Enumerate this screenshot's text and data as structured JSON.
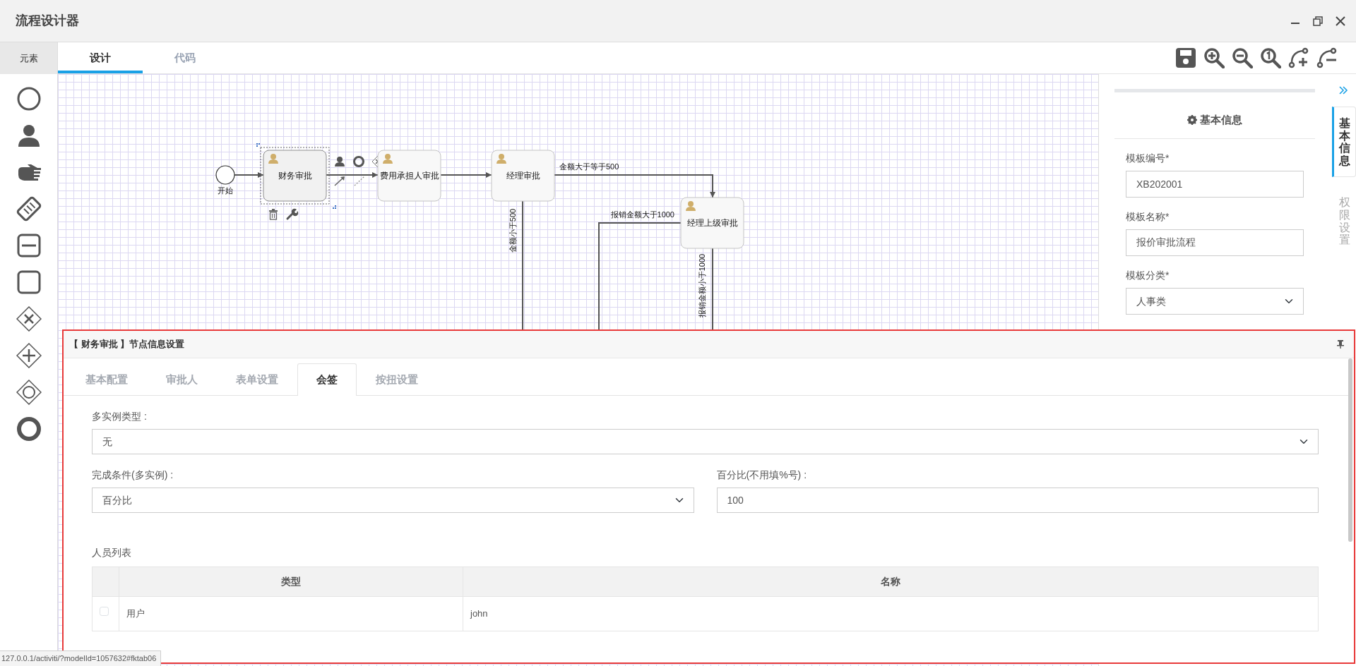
{
  "window": {
    "title": "流程设计器"
  },
  "sidebar": {
    "header": "元素"
  },
  "tabs": [
    {
      "label": "设计",
      "selected": true
    },
    {
      "label": "代码",
      "selected": false
    }
  ],
  "diagram": {
    "nodes": [
      {
        "kind": "start",
        "label": "开始",
        "selected": false
      },
      {
        "kind": "task",
        "label": "财务审批",
        "selected": true
      },
      {
        "kind": "task",
        "label": "费用承担人审批",
        "selected": false
      },
      {
        "kind": "task",
        "label": "经理审批",
        "selected": false
      },
      {
        "kind": "task",
        "label": "经理上级审批",
        "selected": false
      }
    ],
    "flow_labels": [
      {
        "label": "金额大于等于500"
      },
      {
        "label": "金额小于500"
      },
      {
        "label": "报销金额大于1000"
      },
      {
        "label": "报销金额小于1000"
      }
    ]
  },
  "properties": {
    "heading": "基本信息",
    "fields": [
      {
        "label": "模板编号*",
        "kind": "input",
        "value": "XB202001"
      },
      {
        "label": "模板名称*",
        "kind": "input",
        "value": "报价审批流程"
      },
      {
        "label": "模板分类*",
        "kind": "select",
        "value": "人事类"
      }
    ]
  },
  "side_tabs": [
    {
      "label": "基本信息",
      "selected": true
    },
    {
      "label": "权限设置",
      "selected": false
    }
  ],
  "node_settings": {
    "title": "【 财务审批 】节点信息设置",
    "tabs": [
      {
        "label": "基本配置",
        "selected": false
      },
      {
        "label": "审批人",
        "selected": false
      },
      {
        "label": "表单设置",
        "selected": false
      },
      {
        "label": "会签",
        "selected": true
      },
      {
        "label": "按扭设置",
        "selected": false
      }
    ],
    "multi_instance_type": {
      "label": "多实例类型 :",
      "value": "无"
    },
    "completion_condition": {
      "label": "完成条件(多实例) :",
      "value": "百分比"
    },
    "percentage": {
      "label": "百分比(不用填%号) :",
      "value": "100"
    },
    "people": {
      "title": "人员列表",
      "columns": [
        "类型",
        "名称"
      ],
      "rows": [
        {
          "checked": false,
          "cells": [
            "用户",
            "john"
          ]
        }
      ]
    }
  },
  "status_bar": {
    "url": "127.0.0.1/activiti/?modelId=1057632#fktab06"
  }
}
